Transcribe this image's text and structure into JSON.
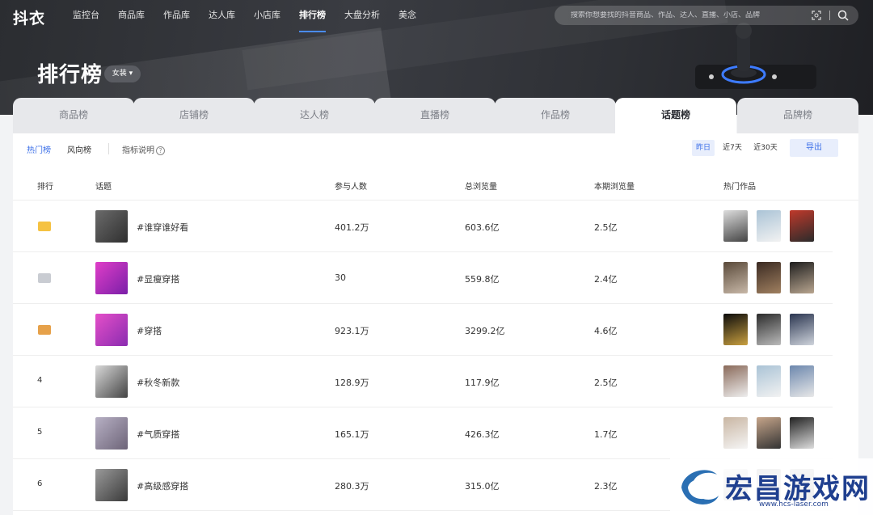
{
  "app": {
    "logo": "抖衣"
  },
  "nav": [
    "监控台",
    "商品库",
    "作品库",
    "达人库",
    "小店库",
    "排行榜",
    "大盘分析",
    "美念"
  ],
  "nav_active": 5,
  "search": {
    "placeholder": "搜索你想要找的抖音商品、作品、达人、直播、小店、品牌"
  },
  "page": {
    "title": "排行榜",
    "category": "女装"
  },
  "tabs": [
    "商品榜",
    "店铺榜",
    "达人榜",
    "直播榜",
    "作品榜",
    "话题榜",
    "品牌榜"
  ],
  "tab_active": 5,
  "subbar": {
    "hot": "热门榜",
    "trend": "风向榜",
    "metric_help": "指标说明",
    "dates": [
      "昨日",
      "近7天",
      "近30天"
    ],
    "export": "导出"
  },
  "table": {
    "headers": [
      "排行",
      "话题",
      "参与人数",
      "总浏览量",
      "本期浏览量",
      "热门作品"
    ],
    "rows": [
      {
        "rank": "1",
        "topic": "#谁穿谁好看",
        "participants": "401.2万",
        "total_views": "603.6亿",
        "period_views": "2.5亿"
      },
      {
        "rank": "2",
        "topic": "#显瘦穿搭",
        "participants": "30",
        "total_views": "559.8亿",
        "period_views": "2.4亿"
      },
      {
        "rank": "3",
        "topic": "#穿搭",
        "participants": "923.1万",
        "total_views": "3299.2亿",
        "period_views": "4.6亿"
      },
      {
        "rank": "4",
        "topic": "#秋冬新款",
        "participants": "128.9万",
        "total_views": "117.9亿",
        "period_views": "2.5亿"
      },
      {
        "rank": "5",
        "topic": "#气质穿搭",
        "participants": "165.1万",
        "total_views": "426.3亿",
        "period_views": "1.7亿"
      },
      {
        "rank": "6",
        "topic": "#高级感穿搭",
        "participants": "280.3万",
        "total_views": "315.0亿",
        "period_views": "2.3亿"
      }
    ]
  },
  "watermark": {
    "text": "宏昌游戏网",
    "url": "www.hcs-laser.com"
  },
  "colors": {
    "accent": "#3a6ee8",
    "gold": "#f5c242",
    "silver": "#c9ccd2",
    "bronze": "#e6a14a"
  }
}
